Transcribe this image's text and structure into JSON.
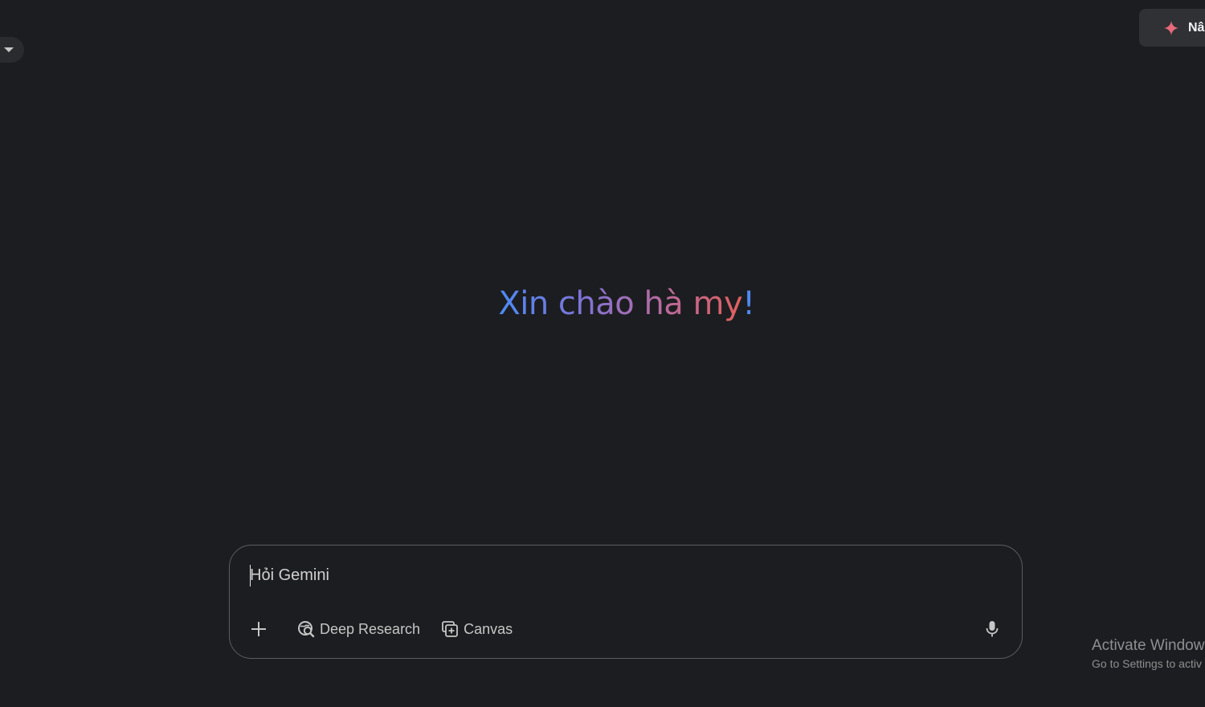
{
  "header": {
    "model_menu_icon": "chevron-down-icon",
    "upgrade": {
      "label": "Nâ",
      "icon": "sparkle-icon",
      "icon_color": "#e86a7a"
    }
  },
  "main": {
    "greeting": "Xin chào hà my!",
    "greeting_gradient": [
      "#4b8bf5",
      "#7d74d8",
      "#b66ba0",
      "#e05f5e"
    ]
  },
  "prompt": {
    "placeholder": "Hỏi Gemini",
    "value": "",
    "add_icon": "plus-icon",
    "tools": [
      {
        "label": "Deep Research",
        "icon": "deep-research-icon"
      },
      {
        "label": "Canvas",
        "icon": "canvas-icon"
      }
    ],
    "mic_icon": "microphone-icon"
  },
  "watermark": {
    "title": "Activate Window",
    "subtitle": "Go to Settings to activ"
  }
}
